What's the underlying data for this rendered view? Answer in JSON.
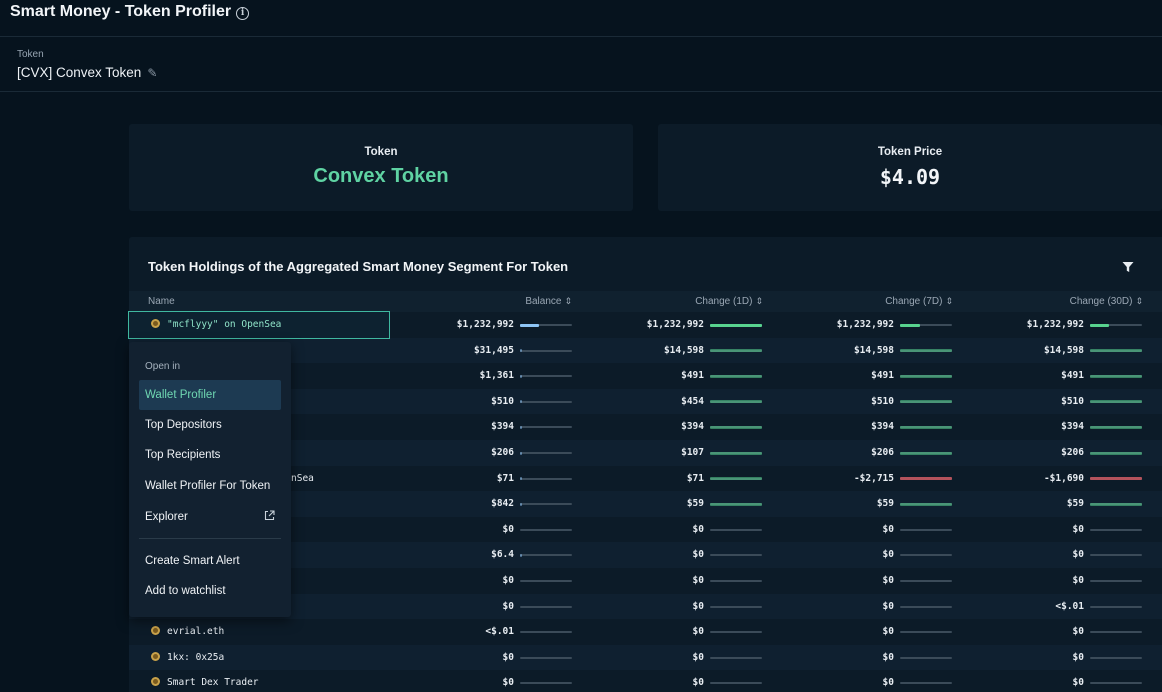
{
  "header": {
    "title": "Smart Money - Token Profiler"
  },
  "token_selector": {
    "label": "Token",
    "value": "[CVX] Convex Token"
  },
  "cards": {
    "token": {
      "label": "Token",
      "value": "Convex Token"
    },
    "price": {
      "label": "Token Price",
      "value": "$4.09"
    }
  },
  "table": {
    "title": "Token Holdings of the Aggregated Smart Money Segment For Token",
    "columns": {
      "name": "Name",
      "balance": "Balance",
      "c1d": "Change (1D)",
      "c7d": "Change (7D)",
      "c30d": "Change (30D)"
    },
    "rows": [
      {
        "name": "\"mcflyyy\" on OpenSea",
        "balance": "$1,232,992",
        "c1d": "$1,232,992",
        "c7d": "$1,232,992",
        "c30d": "$1,232,992"
      },
      {
        "name": "",
        "balance": "$31,495",
        "c1d": "$14,598",
        "c7d": "$14,598",
        "c30d": "$14,598"
      },
      {
        "name": "",
        "balance": "$1,361",
        "c1d": "$491",
        "c7d": "$491",
        "c30d": "$491"
      },
      {
        "name": "",
        "balance": "$510",
        "c1d": "$454",
        "c7d": "$510",
        "c30d": "$510"
      },
      {
        "name": "",
        "balance": "$394",
        "c1d": "$394",
        "c7d": "$394",
        "c30d": "$394"
      },
      {
        "name": "",
        "balance": "$206",
        "c1d": "$107",
        "c7d": "$206",
        "c30d": "$206"
      },
      {
        "name": "nSea",
        "balance": "$71",
        "c1d": "$71",
        "c7d": "-$2,715",
        "c30d": "-$1,690"
      },
      {
        "name": "",
        "balance": "$842",
        "c1d": "$59",
        "c7d": "$59",
        "c30d": "$59"
      },
      {
        "name": "",
        "balance": "$0",
        "c1d": "$0",
        "c7d": "$0",
        "c30d": "$0"
      },
      {
        "name": "",
        "balance": "$6.4",
        "c1d": "$0",
        "c7d": "$0",
        "c30d": "$0"
      },
      {
        "name": "",
        "balance": "$0",
        "c1d": "$0",
        "c7d": "$0",
        "c30d": "$0"
      },
      {
        "name": "",
        "balance": "$0",
        "c1d": "$0",
        "c7d": "$0",
        "c30d": "<$.01"
      },
      {
        "name": "evrial.eth",
        "balance": "<$.01",
        "c1d": "$0",
        "c7d": "$0",
        "c30d": "$0"
      },
      {
        "name": "1kx: 0x25a",
        "balance": "$0",
        "c1d": "$0",
        "c7d": "$0",
        "c30d": "$0"
      },
      {
        "name": "Smart Dex Trader",
        "balance": "$0",
        "c1d": "$0",
        "c7d": "$0",
        "c30d": "$0"
      }
    ]
  },
  "context_menu": {
    "heading": "Open in",
    "items": [
      "Wallet Profiler",
      "Top Depositors",
      "Top Recipients",
      "Wallet Profiler For Token",
      "Explorer"
    ],
    "items2": [
      "Create Smart Alert",
      "Add to watchlist"
    ]
  },
  "colors": {
    "accent_green": "#5fd3a3",
    "bar_green": "#58d38f",
    "bar_blue": "#8ec5f5",
    "bar_red": "#b4535c"
  }
}
